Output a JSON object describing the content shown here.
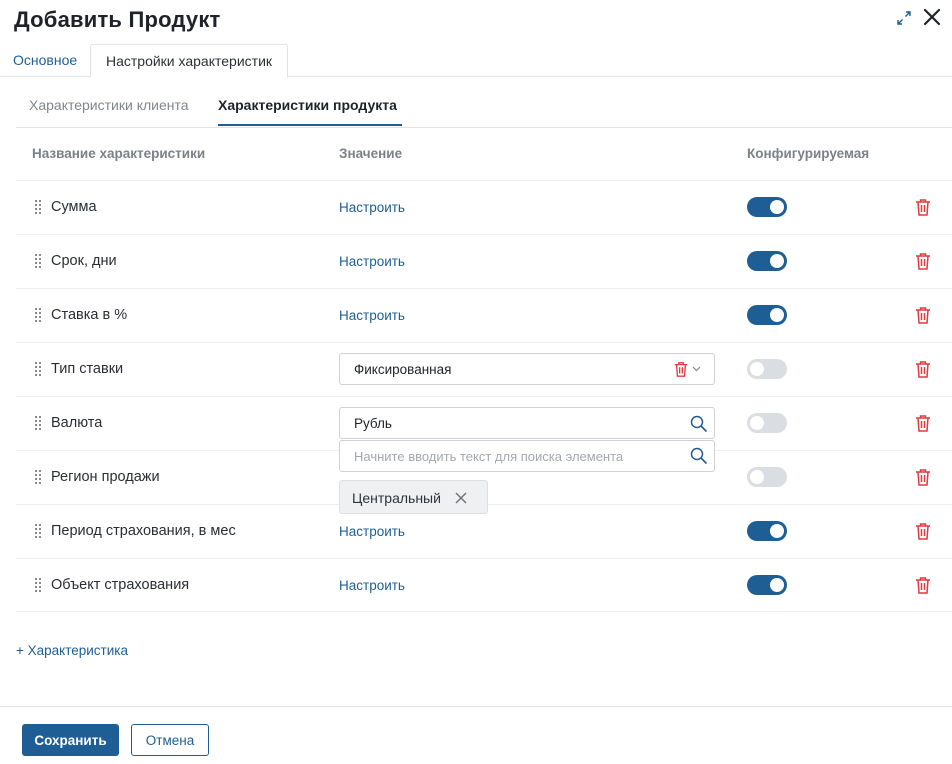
{
  "header": {
    "title": "Добавить Продукт",
    "expand_icon": "expand-icon",
    "close_icon": "close-icon"
  },
  "main_tabs": [
    {
      "label": "Основное",
      "active": false
    },
    {
      "label": "Настройки характеристик",
      "active": true
    }
  ],
  "sub_tabs": [
    {
      "label": "Характеристики клиента",
      "active": false
    },
    {
      "label": "Характеристики продукта",
      "active": true
    }
  ],
  "columns": {
    "name": "Название характеристики",
    "value": "Значение",
    "configurable": "Конфигурируемая"
  },
  "rows": [
    {
      "name": "Сумма",
      "value_type": "link",
      "value_label": "Настроить",
      "configurable": true
    },
    {
      "name": "Срок, дни",
      "value_type": "link",
      "value_label": "Настроить",
      "configurable": true
    },
    {
      "name": "Ставка в %",
      "value_type": "link",
      "value_label": "Настроить",
      "configurable": true
    },
    {
      "name": "Тип ставки",
      "value_type": "select",
      "value_label": "Фиксированная",
      "configurable": false
    },
    {
      "name": "Валюта",
      "value_type": "search",
      "value_label": "Рубль",
      "configurable": false
    },
    {
      "name": "Регион продажи",
      "value_type": "tags",
      "configurable": false
    },
    {
      "name": "Период страхования, в мес",
      "value_type": "link",
      "value_label": "Настроить",
      "configurable": true
    },
    {
      "name": "Объект страхования",
      "value_type": "link",
      "value_label": "Настроить",
      "configurable": true
    }
  ],
  "dropdown": {
    "search_placeholder": "Начните вводить текст для поиска элемента",
    "chip_label": "Центральный"
  },
  "add_characteristic_label": "+ Характеристика",
  "footer": {
    "save_label": "Сохранить",
    "cancel_label": "Отмена"
  },
  "colors": {
    "accent": "#1f5e95",
    "danger": "#e0393e",
    "toggle_off": "#dadde1"
  }
}
